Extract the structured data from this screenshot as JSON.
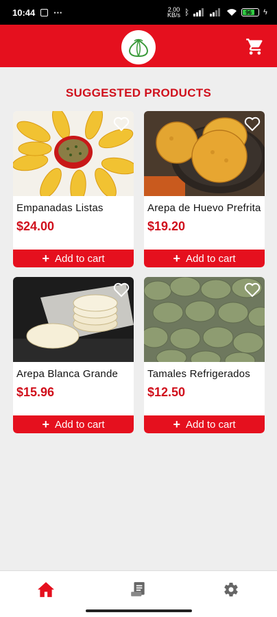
{
  "status": {
    "time": "10:44",
    "net_speed": "2.00\nKB/s",
    "battery": "96"
  },
  "header": {
    "logo_icon": "tamales-logo-icon",
    "cart_icon": "cart-icon"
  },
  "section": {
    "title": "SUGGESTED PRODUCTS"
  },
  "products": [
    {
      "name": "Empanadas Listas",
      "price": "$24.00",
      "add_label": "Add to cart",
      "image": "empanadas-photo"
    },
    {
      "name": "Arepa de Huevo Prefrita",
      "price": "$19.20",
      "add_label": "Add to cart",
      "image": "arepa-huevo-photo"
    },
    {
      "name": "Arepa Blanca Grande",
      "price": "$15.96",
      "add_label": "Add to cart",
      "image": "arepa-blanca-photo"
    },
    {
      "name": "Tamales Refrigerados",
      "price": "$12.50",
      "add_label": "Add to cart",
      "image": "tamales-photo"
    }
  ],
  "nav": {
    "items": [
      "home-icon",
      "orders-icon",
      "settings-icon"
    ]
  },
  "colors": {
    "brand": "#e5101e",
    "price": "#d0101c",
    "background": "#eeeeee"
  }
}
